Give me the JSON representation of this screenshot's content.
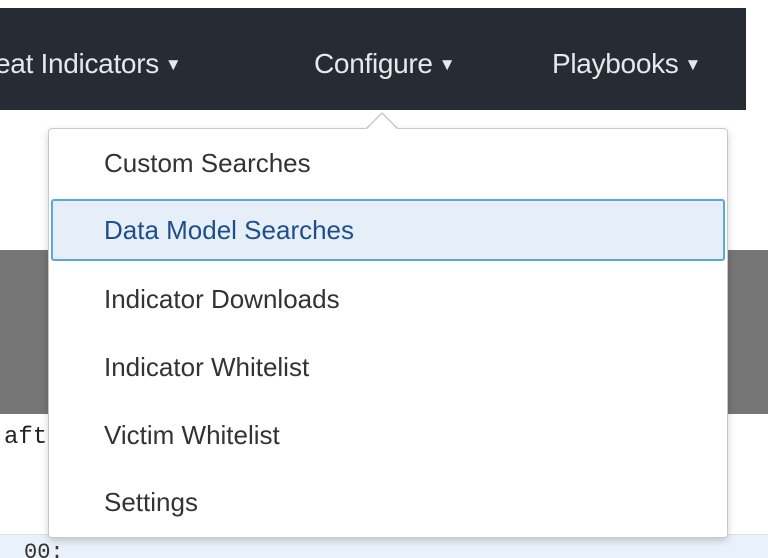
{
  "navbar": {
    "items": [
      {
        "label": "reat Indicators",
        "caret": "▼"
      },
      {
        "label": "Configure",
        "caret": "▼"
      },
      {
        "label": "Playbooks",
        "caret": "▼"
      }
    ]
  },
  "background": {
    "code_line_1": "aft",
    "code_line_2": "00:"
  },
  "dropdown": {
    "items": [
      {
        "label": "Custom Searches"
      },
      {
        "label": "Data Model Searches",
        "highlighted": true
      },
      {
        "label": "Indicator Downloads"
      },
      {
        "label": "Indicator Whitelist"
      },
      {
        "label": "Victim Whitelist"
      },
      {
        "label": "Settings"
      }
    ]
  },
  "colors": {
    "navbar_bg": "#252c33",
    "highlight_border": "#5aa7e0",
    "highlight_bg": "#e6eff8",
    "highlight_text": "#1e4f8c"
  }
}
